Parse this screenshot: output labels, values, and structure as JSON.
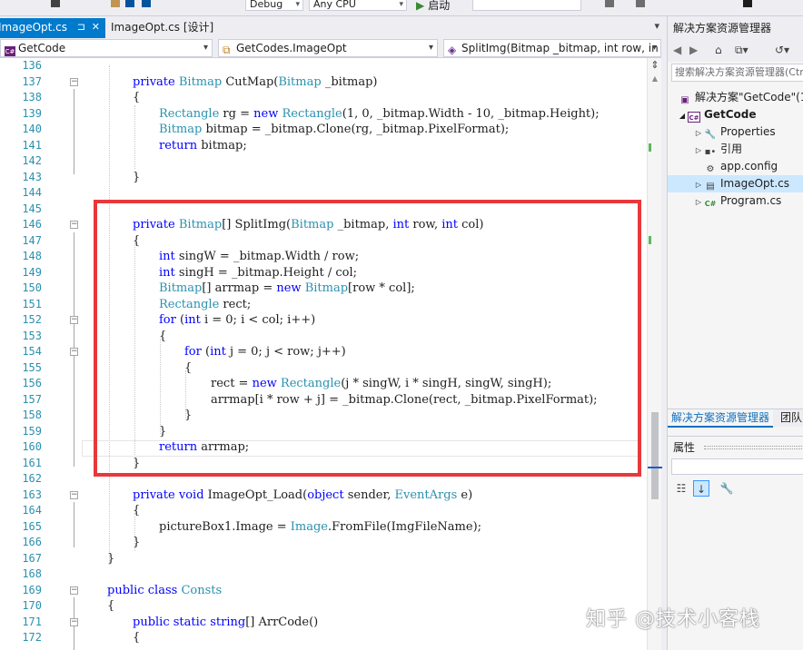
{
  "toolbar": {
    "config": "Debug",
    "platform": "Any CPU",
    "start_label": "启动"
  },
  "tabs": [
    {
      "label": "ImageOpt.cs",
      "pin": "⊐",
      "close": "✕"
    },
    {
      "label": "ImageOpt.cs [设计]"
    }
  ],
  "nav": {
    "project": "GetCode",
    "class": "GetCodes.ImageOpt",
    "member": "SplitImg(Bitmap _bitmap, int row, in"
  },
  "editor": {
    "accent": "#007acc",
    "highlight_color": "#e8383b",
    "lines": [
      {
        "n": "136",
        "t": ""
      },
      {
        "n": "137",
        "t": ""
      },
      {
        "n": "138",
        "t": "{"
      },
      {
        "n": "139",
        "t": ""
      },
      {
        "n": "140",
        "t": ""
      },
      {
        "n": "141",
        "t": ""
      },
      {
        "n": "142",
        "t": ""
      },
      {
        "n": "143",
        "t": "}"
      },
      {
        "n": "144",
        "t": ""
      },
      {
        "n": "145",
        "t": ""
      },
      {
        "n": "146",
        "t": ""
      },
      {
        "n": "147",
        "t": "{"
      },
      {
        "n": "148",
        "t": ""
      },
      {
        "n": "149",
        "t": ""
      },
      {
        "n": "150",
        "t": ""
      },
      {
        "n": "151",
        "t": ""
      },
      {
        "n": "152",
        "t": ""
      },
      {
        "n": "153",
        "t": "{"
      },
      {
        "n": "154",
        "t": ""
      },
      {
        "n": "155",
        "t": "{"
      },
      {
        "n": "156",
        "t": ""
      },
      {
        "n": "157",
        "t": "arrmap[i * row + j] = _bitmap.Clone(rect, _bitmap.PixelFormat);"
      },
      {
        "n": "158",
        "t": "}"
      },
      {
        "n": "159",
        "t": "}"
      },
      {
        "n": "160",
        "t": ""
      },
      {
        "n": "161",
        "t": "}"
      },
      {
        "n": "162",
        "t": ""
      },
      {
        "n": "163",
        "t": ""
      },
      {
        "n": "164",
        "t": "{"
      },
      {
        "n": "165",
        "t": ""
      },
      {
        "n": "166",
        "t": "}"
      },
      {
        "n": "167",
        "t": "}"
      },
      {
        "n": "168",
        "t": ""
      },
      {
        "n": "169",
        "t": ""
      },
      {
        "n": "170",
        "t": "{"
      },
      {
        "n": "171",
        "t": ""
      },
      {
        "n": "172",
        "t": "{"
      }
    ],
    "tokens": {
      "private": "private",
      "public": "public",
      "static": "static",
      "void": "void",
      "class": "class",
      "new": "new",
      "int": "int",
      "for": "for",
      "return": "return",
      "object": "object",
      "string": "string",
      "Bitmap": "Bitmap",
      "Rectangle": "Rectangle",
      "EventArgs": "EventArgs",
      "Image": "Image",
      "Consts": "Consts",
      "l137a": " CutMap(",
      "l137b": " _bitmap)",
      "l139a": " rg = ",
      "l139b": "(1, 0, _bitmap.Width - 10, _bitmap.Height);",
      "l140a": " bitmap = _bitmap.Clone(rg, _bitmap.PixelFormat);",
      "l141a": " bitmap;",
      "l146a": "[] SplitImg(",
      "l146b": " _bitmap, ",
      "l146c": " row, ",
      "l146d": " col)",
      "l148a": " singW = _bitmap.Width / row;",
      "l149a": " singH = _bitmap.Height / col;",
      "l150a": "[] arrmap = ",
      "l150b": "[row * col];",
      "l151a": " rect;",
      "l152a": " (",
      "l152b": " i = 0; i < col; i++)",
      "l154b": " j = 0; j < row; j++)",
      "l156a": "rect = ",
      "l156b": "(j * singW, i * singH, singW, singH);",
      "l160a": " arrmap;",
      "l163a": " ImageOpt_Load(",
      "l163b": " sender, ",
      "l163c": " e)",
      "l165a": "pictureBox1.Image = ",
      "l165b": ".FromFile(ImgFileName);",
      "l171a": "[] ArrCode()"
    }
  },
  "solution_explorer": {
    "title": "解决方案资源管理器",
    "search_placeholder": "搜索解决方案资源管理器(Ctrl+;)",
    "tree": [
      {
        "label": "解决方案\"GetCode\"(1",
        "icon": "solution-icon"
      },
      {
        "label": "GetCode",
        "icon": "csharp-project-icon"
      },
      {
        "label": "Properties",
        "icon": "wrench-icon"
      },
      {
        "label": "引用",
        "icon": "references-icon"
      },
      {
        "label": "app.config",
        "icon": "config-icon"
      },
      {
        "label": "ImageOpt.cs",
        "icon": "form-icon"
      },
      {
        "label": "Program.cs",
        "icon": "csharp-file-icon"
      }
    ],
    "bottom_tabs": [
      "解决方案资源管理器",
      "团队"
    ]
  },
  "properties": {
    "title": "属性"
  },
  "watermark": "知乎 @技术小客栈"
}
